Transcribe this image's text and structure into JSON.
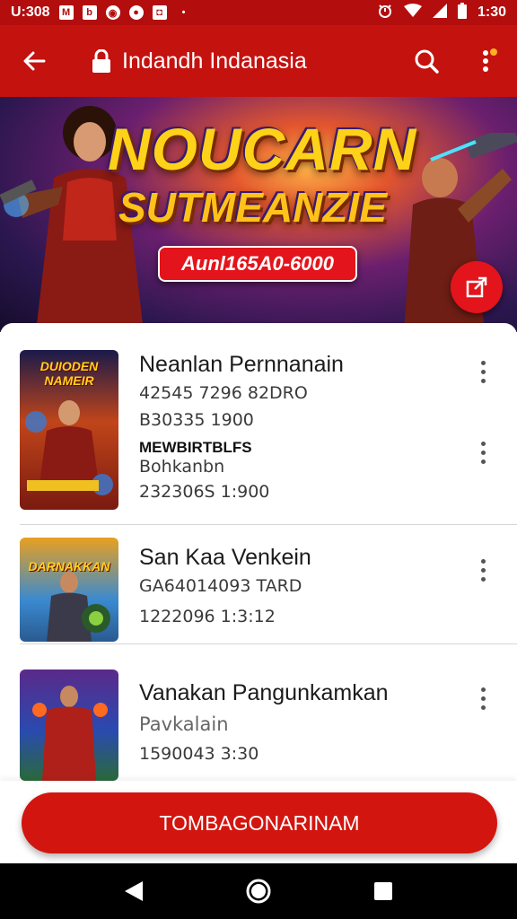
{
  "status_bar": {
    "left_time": "U:308",
    "time": "1:30",
    "icons": [
      "gmail-icon",
      "square-app-icon",
      "messenger-icon",
      "chat-icon",
      "camera-icon",
      "dot-icon"
    ],
    "right_icons": [
      "alarm-icon",
      "wifi-icon",
      "signal-icon",
      "battery-icon"
    ]
  },
  "app_bar": {
    "title": "Indandh Indanasia",
    "icons": [
      "back-arrow-icon",
      "lock-icon",
      "search-icon",
      "more-vertical-icon"
    ]
  },
  "banner": {
    "title_line1": "NOUCARN",
    "title_line2": "SUTMEANZIE",
    "pill_label": "Aunl165A0-6000"
  },
  "list": [
    {
      "title": "Neanlan Pernnanain",
      "line1": "42545 7296 82DRO",
      "line2": "B30335 1900",
      "line3": "MEWBIRTBLFS",
      "line4": "Bohkanbn",
      "line5": "232306S 1:900",
      "thumb_text": "DUIODEN NAMEIR"
    },
    {
      "title": "San Kaa Venkein",
      "line1": "GA64014093 TARD",
      "line2": "1222096 1:3:12",
      "thumb_text": "DARNAKKAN"
    },
    {
      "title": "Vanakan Pangunkamkan",
      "line1": "Pavkalain",
      "line2": "1590043 3:30"
    }
  ],
  "primary_button": {
    "label": "TOMBAGONARINAM"
  },
  "colors": {
    "primary": "#c4120f",
    "status_bar": "#b30d0d",
    "button": "#d3150f"
  }
}
